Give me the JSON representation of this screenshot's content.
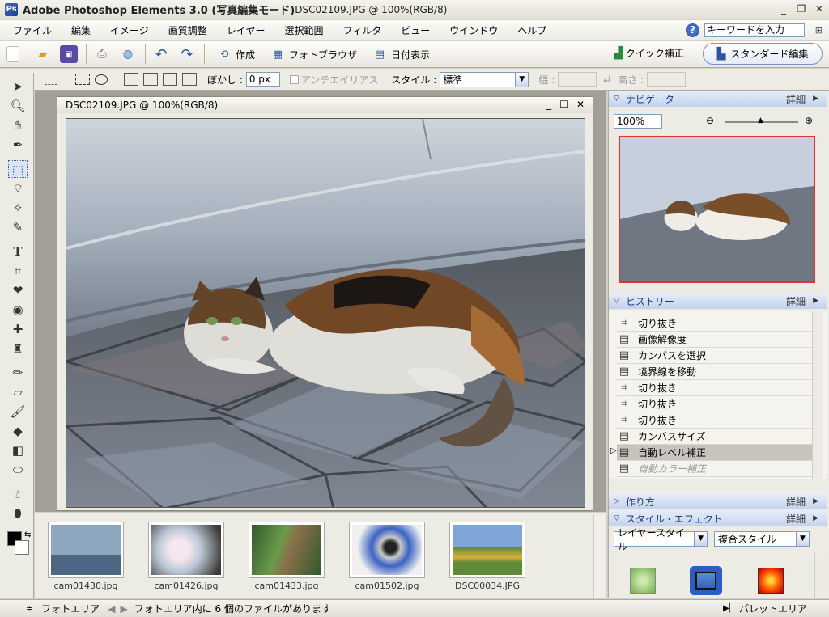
{
  "titlebar": {
    "app_name": "Adobe Photoshop Elements 3.0 (写真編集モード)",
    "document": "DSC02109.JPG @ 100%(RGB/8)"
  },
  "menu": [
    "ファイル",
    "編集",
    "イメージ",
    "画質調整",
    "レイヤー",
    "選択範囲",
    "フィルタ",
    "ビュー",
    "ウインドウ",
    "ヘルプ"
  ],
  "help": {
    "search_value": "キーワードを入力"
  },
  "shortcuts": {
    "create": "作成",
    "photo_browser": "フォトブラウザ",
    "date_view": "日付表示",
    "quick_fix": "クイック補正",
    "standard_edit": "スタンダード編集"
  },
  "options": {
    "feather_label": "ぼかし :",
    "feather_value": "0 px",
    "antialias_label": "アンチエイリアス",
    "style_label": "スタイル :",
    "style_value": "標準",
    "width_label": "幅 :",
    "height_label": "高さ :"
  },
  "document_window": {
    "title": "DSC02109.JPG @ 100%(RGB/8)"
  },
  "photo_bin": {
    "thumbnails": [
      {
        "caption": "cam01430.jpg"
      },
      {
        "caption": "cam01426.jpg"
      },
      {
        "caption": "cam01433.jpg"
      },
      {
        "caption": "cam01502.jpg"
      },
      {
        "caption": "DSC00034.JPG"
      }
    ]
  },
  "navigator": {
    "title": "ナビゲータ",
    "more": "詳細",
    "zoom": "100%"
  },
  "history": {
    "title": "ヒストリー",
    "more": "詳細",
    "items": [
      {
        "label": "切り抜き",
        "icon": "crop-icon"
      },
      {
        "label": "画像解像度",
        "icon": "document-icon"
      },
      {
        "label": "カンバスを選択",
        "icon": "document-icon"
      },
      {
        "label": "境界線を移動",
        "icon": "document-icon"
      },
      {
        "label": "切り抜き",
        "icon": "crop-icon"
      },
      {
        "label": "切り抜き",
        "icon": "crop-icon"
      },
      {
        "label": "切り抜き",
        "icon": "crop-icon"
      },
      {
        "label": "カンバスサイズ",
        "icon": "document-icon"
      },
      {
        "label": "自動レベル補正",
        "icon": "document-icon",
        "selected": true
      },
      {
        "label": "自動カラー補正",
        "icon": "document-icon",
        "dimmed": true
      }
    ]
  },
  "recipes": {
    "title": "作り方",
    "more": "詳細"
  },
  "styles": {
    "title": "スタイル・エフェクト",
    "more": "詳細",
    "category": "レイヤースタイル",
    "library": "複合スタイル"
  },
  "status": {
    "photo_bin_label": "フォトエリア",
    "message": "フォトエリア内に 6 個のファイルがあります",
    "palette_bin": "パレットエリア"
  }
}
